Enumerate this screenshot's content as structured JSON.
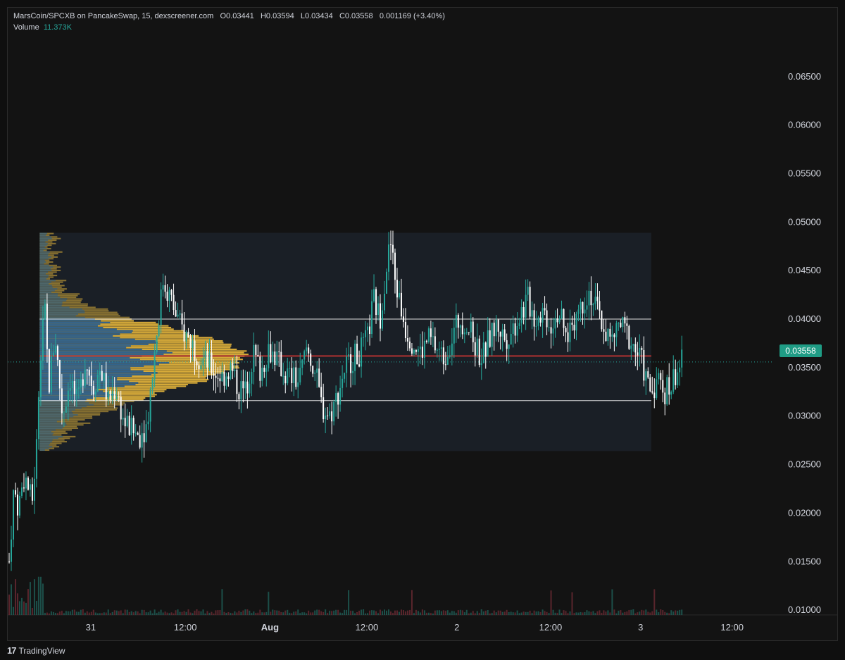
{
  "header": {
    "pair": "MarsCoin/SPCXB on PancakeSwap, 15, dexscreener.com",
    "open": "O0.03441",
    "high": "H0.03594",
    "low": "L0.03434",
    "close": "C0.03558",
    "change": "0.001169 (+3.40%)",
    "volume_label": "Volume",
    "volume_value": "11.373K"
  },
  "footer": {
    "brand": "TradingView",
    "logo_glyph": "17"
  },
  "colors": {
    "up": "#26a69a",
    "down": "#ffffff",
    "poc": "#e53935",
    "profile_yellow": "#e0b23a",
    "profile_blue": "#2a5f8f",
    "range_box": "#1a1f26",
    "price_tag": "#1f9c85"
  },
  "chart_data": {
    "type": "candlestick",
    "y_axis": {
      "ticks": [
        "0.06500",
        "0.06000",
        "0.05500",
        "0.05000",
        "0.04500",
        "0.04000",
        "0.03500",
        "0.03000",
        "0.02500",
        "0.02000",
        "0.01500",
        "0.01000"
      ],
      "range": [
        0.0095,
        0.0692
      ]
    },
    "x_axis": {
      "ticks": [
        "31",
        "12:00",
        "Aug",
        "12:00",
        "2",
        "12:00",
        "3",
        "12:00"
      ],
      "range": [
        0,
        100
      ]
    },
    "x_tick_positions": [
      10.7,
      23.1,
      34.2,
      46.9,
      58.7,
      71.0,
      82.8,
      94.8
    ],
    "last_price": "0.03558",
    "last_price_value": 0.03558,
    "volume_profile": {
      "price_range": [
        0.0264,
        0.0489
      ],
      "time_range": [
        4.0,
        84.2
      ],
      "poc": 0.0362,
      "value_area_high": 0.04,
      "value_area_low": 0.0316
    },
    "price_anchors": [
      [
        0,
        0.015
      ],
      [
        0.6,
        0.0225
      ],
      [
        1.2,
        0.0205
      ],
      [
        2.0,
        0.024
      ],
      [
        3.0,
        0.021
      ],
      [
        3.6,
        0.027
      ],
      [
        4.0,
        0.0355
      ],
      [
        4.6,
        0.042
      ],
      [
        5.2,
        0.033
      ],
      [
        6.0,
        0.0385
      ],
      [
        7.0,
        0.03
      ],
      [
        8.0,
        0.034
      ],
      [
        9.0,
        0.031
      ],
      [
        10.0,
        0.036
      ],
      [
        11.0,
        0.033
      ],
      [
        12.0,
        0.035
      ],
      [
        13.0,
        0.0315
      ],
      [
        14.0,
        0.033
      ],
      [
        15.0,
        0.0295
      ],
      [
        16.0,
        0.0285
      ],
      [
        17.0,
        0.028
      ],
      [
        18.0,
        0.029
      ],
      [
        18.6,
        0.033
      ],
      [
        19.4,
        0.039
      ],
      [
        20.2,
        0.044
      ],
      [
        21.0,
        0.0425
      ],
      [
        21.8,
        0.0405
      ],
      [
        22.6,
        0.039
      ],
      [
        24.0,
        0.0375
      ],
      [
        25.0,
        0.036
      ],
      [
        26.0,
        0.0355
      ],
      [
        27.0,
        0.0345
      ],
      [
        28.0,
        0.034
      ],
      [
        29.0,
        0.035
      ],
      [
        30.0,
        0.033
      ],
      [
        31.0,
        0.0325
      ],
      [
        32.0,
        0.0365
      ],
      [
        33.0,
        0.0345
      ],
      [
        34.0,
        0.037
      ],
      [
        35.0,
        0.036
      ],
      [
        36.0,
        0.0345
      ],
      [
        37.0,
        0.034
      ],
      [
        38.0,
        0.0335
      ],
      [
        39.0,
        0.037
      ],
      [
        40.0,
        0.035
      ],
      [
        41.0,
        0.031
      ],
      [
        42.0,
        0.03
      ],
      [
        43.0,
        0.032
      ],
      [
        44.0,
        0.035
      ],
      [
        45.0,
        0.036
      ],
      [
        46.0,
        0.0365
      ],
      [
        47.0,
        0.038
      ],
      [
        47.8,
        0.042
      ],
      [
        48.6,
        0.04
      ],
      [
        49.4,
        0.045
      ],
      [
        50.0,
        0.048
      ],
      [
        50.6,
        0.044
      ],
      [
        51.4,
        0.041
      ],
      [
        52.0,
        0.039
      ],
      [
        53.0,
        0.0375
      ],
      [
        54.0,
        0.0365
      ],
      [
        55.0,
        0.038
      ],
      [
        56.0,
        0.037
      ],
      [
        57.0,
        0.036
      ],
      [
        58.0,
        0.038
      ],
      [
        59.0,
        0.04
      ],
      [
        60.0,
        0.0395
      ],
      [
        61.0,
        0.0375
      ],
      [
        62.0,
        0.036
      ],
      [
        63.0,
        0.038
      ],
      [
        64.0,
        0.0395
      ],
      [
        65.0,
        0.038
      ],
      [
        66.0,
        0.039
      ],
      [
        67.0,
        0.0405
      ],
      [
        68.0,
        0.042
      ],
      [
        69.0,
        0.04
      ],
      [
        70.0,
        0.041
      ],
      [
        71.0,
        0.0395
      ],
      [
        72.0,
        0.041
      ],
      [
        73.0,
        0.038
      ],
      [
        74.0,
        0.04
      ],
      [
        75.0,
        0.0415
      ],
      [
        76.0,
        0.043
      ],
      [
        77.0,
        0.041
      ],
      [
        78.0,
        0.039
      ],
      [
        79.0,
        0.0375
      ],
      [
        80.0,
        0.0395
      ],
      [
        81.0,
        0.0385
      ],
      [
        82.0,
        0.037
      ],
      [
        83.0,
        0.0355
      ],
      [
        83.6,
        0.0335
      ],
      [
        84.2,
        0.0325
      ],
      [
        85.0,
        0.034
      ],
      [
        85.8,
        0.0325
      ],
      [
        86.6,
        0.033
      ],
      [
        87.4,
        0.0345
      ],
      [
        88.2,
        0.0356
      ]
    ]
  }
}
